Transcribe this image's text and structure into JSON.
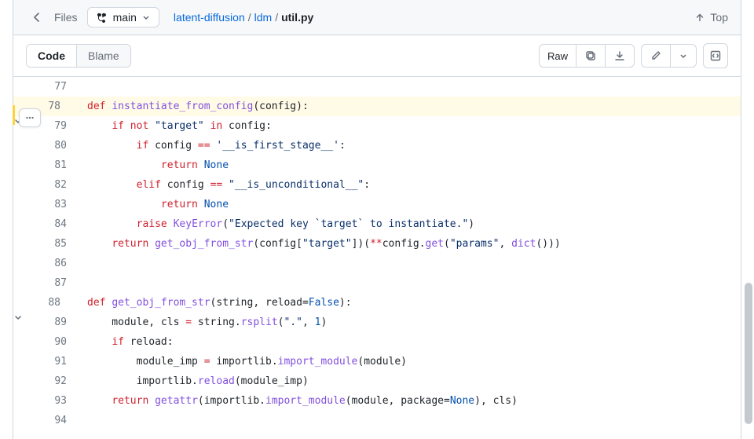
{
  "header": {
    "files_label": "Files",
    "branch": "main",
    "breadcrumb": {
      "root": "latent-diffusion",
      "folder": "ldm",
      "file": "util.py"
    },
    "top_label": "Top"
  },
  "toolbar": {
    "code_label": "Code",
    "blame_label": "Blame",
    "raw_label": "Raw"
  },
  "code": {
    "lines": [
      {
        "n": 77,
        "fold": false,
        "hl": false,
        "tokens": []
      },
      {
        "n": 78,
        "fold": true,
        "hl": true,
        "tokens": [
          {
            "c": "kw",
            "t": "def "
          },
          {
            "c": "fn",
            "t": "instantiate_from_config"
          },
          {
            "c": "op",
            "t": "("
          },
          {
            "c": "op",
            "t": "config"
          },
          {
            "c": "op",
            "t": "):"
          }
        ]
      },
      {
        "n": 79,
        "fold": false,
        "hl": false,
        "indent": 1,
        "tokens": [
          {
            "c": "kw",
            "t": "if"
          },
          {
            "c": "op",
            "t": " "
          },
          {
            "c": "kw",
            "t": "not"
          },
          {
            "c": "op",
            "t": " "
          },
          {
            "c": "str",
            "t": "\"target\""
          },
          {
            "c": "op",
            "t": " "
          },
          {
            "c": "kw",
            "t": "in"
          },
          {
            "c": "op",
            "t": " config:"
          }
        ]
      },
      {
        "n": 80,
        "fold": false,
        "hl": false,
        "indent": 2,
        "tokens": [
          {
            "c": "kw",
            "t": "if"
          },
          {
            "c": "op",
            "t": " config "
          },
          {
            "c": "kw",
            "t": "=="
          },
          {
            "c": "op",
            "t": " "
          },
          {
            "c": "str",
            "t": "'__is_first_stage__'"
          },
          {
            "c": "op",
            "t": ":"
          }
        ]
      },
      {
        "n": 81,
        "fold": false,
        "hl": false,
        "indent": 3,
        "tokens": [
          {
            "c": "kw",
            "t": "return"
          },
          {
            "c": "op",
            "t": " "
          },
          {
            "c": "const",
            "t": "None"
          }
        ]
      },
      {
        "n": 82,
        "fold": false,
        "hl": false,
        "indent": 2,
        "tokens": [
          {
            "c": "kw",
            "t": "elif"
          },
          {
            "c": "op",
            "t": " config "
          },
          {
            "c": "kw",
            "t": "=="
          },
          {
            "c": "op",
            "t": " "
          },
          {
            "c": "str",
            "t": "\"__is_unconditional__\""
          },
          {
            "c": "op",
            "t": ":"
          }
        ]
      },
      {
        "n": 83,
        "fold": false,
        "hl": false,
        "indent": 3,
        "tokens": [
          {
            "c": "kw",
            "t": "return"
          },
          {
            "c": "op",
            "t": " "
          },
          {
            "c": "const",
            "t": "None"
          }
        ]
      },
      {
        "n": 84,
        "fold": false,
        "hl": false,
        "indent": 2,
        "tokens": [
          {
            "c": "kw",
            "t": "raise"
          },
          {
            "c": "op",
            "t": " "
          },
          {
            "c": "fn",
            "t": "KeyError"
          },
          {
            "c": "op",
            "t": "("
          },
          {
            "c": "str",
            "t": "\"Expected key `target` to instantiate.\""
          },
          {
            "c": "op",
            "t": ")"
          }
        ]
      },
      {
        "n": 85,
        "fold": false,
        "hl": false,
        "indent": 1,
        "tokens": [
          {
            "c": "kw",
            "t": "return"
          },
          {
            "c": "op",
            "t": " "
          },
          {
            "c": "fn",
            "t": "get_obj_from_str"
          },
          {
            "c": "op",
            "t": "(config["
          },
          {
            "c": "str",
            "t": "\"target\""
          },
          {
            "c": "op",
            "t": "])("
          },
          {
            "c": "kw",
            "t": "**"
          },
          {
            "c": "op",
            "t": "config."
          },
          {
            "c": "fn",
            "t": "get"
          },
          {
            "c": "op",
            "t": "("
          },
          {
            "c": "str",
            "t": "\"params\""
          },
          {
            "c": "op",
            "t": ", "
          },
          {
            "c": "fn",
            "t": "dict"
          },
          {
            "c": "op",
            "t": "()))"
          }
        ]
      },
      {
        "n": 86,
        "fold": false,
        "hl": false,
        "tokens": []
      },
      {
        "n": 87,
        "fold": false,
        "hl": false,
        "tokens": []
      },
      {
        "n": 88,
        "fold": true,
        "hl": false,
        "tokens": [
          {
            "c": "kw",
            "t": "def "
          },
          {
            "c": "fn",
            "t": "get_obj_from_str"
          },
          {
            "c": "op",
            "t": "(string, reload="
          },
          {
            "c": "const",
            "t": "False"
          },
          {
            "c": "op",
            "t": "):"
          }
        ]
      },
      {
        "n": 89,
        "fold": false,
        "hl": false,
        "indent": 1,
        "tokens": [
          {
            "c": "op",
            "t": "module, cls "
          },
          {
            "c": "kw",
            "t": "="
          },
          {
            "c": "op",
            "t": " string."
          },
          {
            "c": "fn",
            "t": "rsplit"
          },
          {
            "c": "op",
            "t": "("
          },
          {
            "c": "str",
            "t": "\".\""
          },
          {
            "c": "op",
            "t": ", "
          },
          {
            "c": "const",
            "t": "1"
          },
          {
            "c": "op",
            "t": ")"
          }
        ]
      },
      {
        "n": 90,
        "fold": false,
        "hl": false,
        "indent": 1,
        "tokens": [
          {
            "c": "kw",
            "t": "if"
          },
          {
            "c": "op",
            "t": " reload:"
          }
        ]
      },
      {
        "n": 91,
        "fold": false,
        "hl": false,
        "indent": 2,
        "tokens": [
          {
            "c": "op",
            "t": "module_imp "
          },
          {
            "c": "kw",
            "t": "="
          },
          {
            "c": "op",
            "t": " importlib."
          },
          {
            "c": "fn",
            "t": "import_module"
          },
          {
            "c": "op",
            "t": "(module)"
          }
        ]
      },
      {
        "n": 92,
        "fold": false,
        "hl": false,
        "indent": 2,
        "tokens": [
          {
            "c": "op",
            "t": "importlib."
          },
          {
            "c": "fn",
            "t": "reload"
          },
          {
            "c": "op",
            "t": "(module_imp)"
          }
        ]
      },
      {
        "n": 93,
        "fold": false,
        "hl": false,
        "indent": 1,
        "tokens": [
          {
            "c": "kw",
            "t": "return"
          },
          {
            "c": "op",
            "t": " "
          },
          {
            "c": "fn",
            "t": "getattr"
          },
          {
            "c": "op",
            "t": "(importlib."
          },
          {
            "c": "fn",
            "t": "import_module"
          },
          {
            "c": "op",
            "t": "(module, package="
          },
          {
            "c": "const",
            "t": "None"
          },
          {
            "c": "op",
            "t": "), cls)"
          }
        ]
      },
      {
        "n": 94,
        "fold": false,
        "hl": false,
        "tokens": []
      }
    ]
  }
}
